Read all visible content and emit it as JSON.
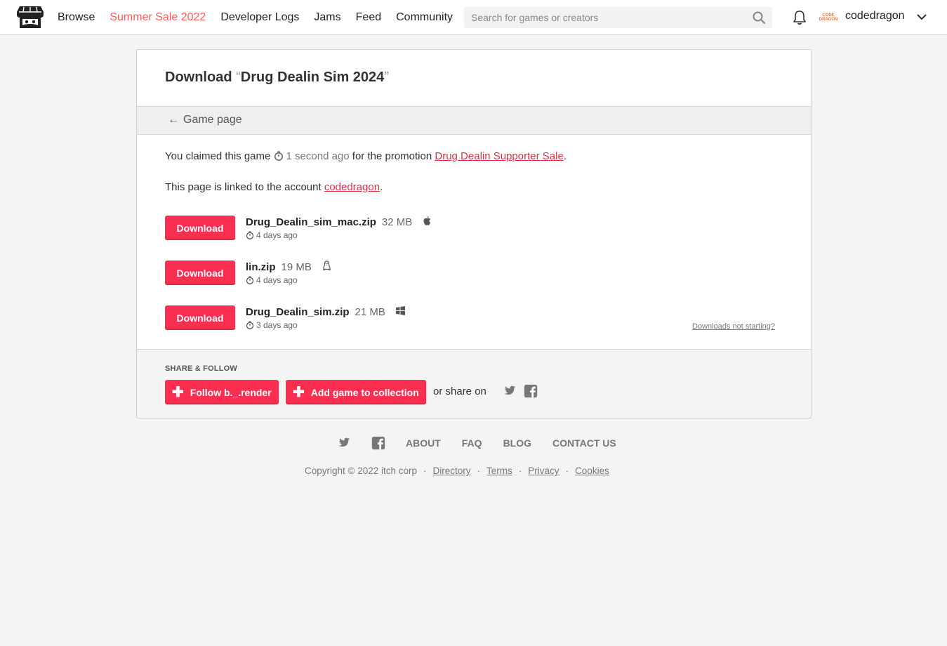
{
  "header": {
    "nav": [
      "Browse",
      "Summer Sale 2022",
      "Developer Logs",
      "Jams",
      "Feed",
      "Community"
    ],
    "search_placeholder": "Search for games or creators",
    "avatar_text": [
      "CODE",
      "DRAGON"
    ],
    "username": "codedragon",
    "accent_color": "#fa5c5c"
  },
  "page": {
    "title_prefix": "Download",
    "open_quote": "“",
    "game_title": "Drug Dealin Sim 2024",
    "close_quote": "”",
    "back_label": "Game page",
    "claimed_prefix": "You claimed this game",
    "claimed_time": "1 second ago",
    "claimed_middle": "for the promotion",
    "promotion": "Drug Dealin Supporter Sale",
    "claimed_suffix": ".",
    "linked_prefix": "This page is linked to the account",
    "linked_account": "codedragon",
    "linked_suffix": "."
  },
  "downloads": [
    {
      "button": "Download",
      "name": "Drug_Dealin_sim_mac.zip",
      "size": "32 MB",
      "platform_icon": "apple-icon",
      "date": "4 days ago"
    },
    {
      "button": "Download",
      "name": "lin.zip",
      "size": "19 MB",
      "platform_icon": "linux-icon",
      "date": "4 days ago"
    },
    {
      "button": "Download",
      "name": "Drug_Dealin_sim.zip",
      "size": "21 MB",
      "platform_icon": "windows-icon",
      "date": "3 days ago"
    }
  ],
  "not_starting": "Downloads not starting?",
  "share": {
    "label": "SHARE & FOLLOW",
    "follow_button": "Follow b._.render",
    "collection_button": "Add game to collection",
    "or_share": "or share on",
    "button_color": "#fa2f4f"
  },
  "footer": {
    "links": [
      "ABOUT",
      "FAQ",
      "BLOG",
      "CONTACT US"
    ],
    "copyright": "Copyright © 2022 itch corp",
    "legal": [
      "Directory",
      "Terms",
      "Privacy",
      "Cookies"
    ]
  }
}
